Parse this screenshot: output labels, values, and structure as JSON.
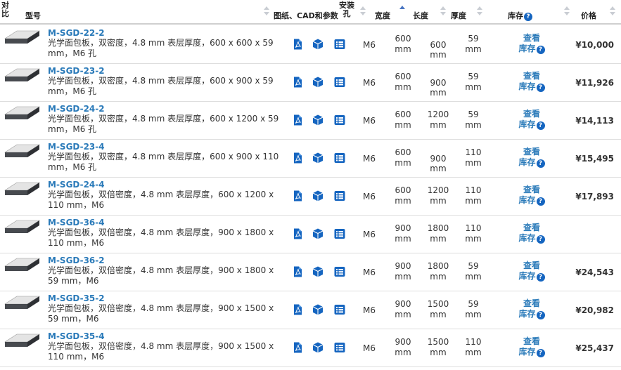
{
  "header": {
    "compare": "对比",
    "model": "型号",
    "docs": "图纸、CAD和参数",
    "holes": "安装孔",
    "width": "宽度",
    "length": "长度",
    "thickness": "厚度",
    "stock": "库存",
    "price": "价格"
  },
  "stock_link": "查看库存",
  "colors": {
    "link": "#2a7ab9",
    "icon": "#1565c0",
    "border": "#dedede"
  },
  "rows": [
    {
      "model": "M-SGD-22-2",
      "desc": "光学面包板，双密度，4.8 mm 表层厚度，600 x 600 x 59 mm，M6 孔",
      "holes": "M6",
      "width": "600 mm",
      "length": "600 mm",
      "thickness": "59 mm",
      "price": "¥10,000"
    },
    {
      "model": "M-SGD-23-2",
      "desc": "光学面包板，双密度，4.8 mm 表层厚度，600 x 900 x 59 mm，M6 孔",
      "holes": "M6",
      "width": "600 mm",
      "length": "900 mm",
      "thickness": "59 mm",
      "price": "¥11,926"
    },
    {
      "model": "M-SGD-24-2",
      "desc": "光学面包板，双密度，4.8 mm 表层厚度，600 x 1200 x 59 mm，M6 孔",
      "holes": "M6",
      "width": "600 mm",
      "length": "1200 mm",
      "thickness": "59 mm",
      "price": "¥14,113"
    },
    {
      "model": "M-SGD-23-4",
      "desc": "光学面包板，双密度，4.8 mm 表层厚度，600 x 900 x 110 mm，M6 孔",
      "holes": "M6",
      "width": "600 mm",
      "length": "900 mm",
      "thickness": "110 mm",
      "price": "¥15,495"
    },
    {
      "model": "M-SGD-24-4",
      "desc": "光学面包板，双倍密度，4.8 mm 表层厚度，600 x 1200 x 110 mm，M6",
      "holes": "M6",
      "width": "600 mm",
      "length": "1200 mm",
      "thickness": "110 mm",
      "price": "¥17,893"
    },
    {
      "model": "M-SGD-36-4",
      "desc": "光学面包板，双倍密度，4.8 mm 表层厚度，900 x 1800 x 110 mm，M6",
      "holes": "M6",
      "width": "900 mm",
      "length": "1800 mm",
      "thickness": "110 mm",
      "price": ""
    },
    {
      "model": "M-SGD-36-2",
      "desc": "光学面包板，双倍密度，4.8 mm 表层厚度，900 x 1800 x 59 mm，M6",
      "holes": "M6",
      "width": "900 mm",
      "length": "1800 mm",
      "thickness": "59 mm",
      "price": "¥24,543"
    },
    {
      "model": "M-SGD-35-2",
      "desc": "光学面包板，双倍密度，4.8 mm 表层厚度，900 x 1500 x 59 mm，M6",
      "holes": "M6",
      "width": "900 mm",
      "length": "1500 mm",
      "thickness": "59 mm",
      "price": "¥20,982"
    },
    {
      "model": "M-SGD-35-4",
      "desc": "光学面包板，双倍密度，4.8 mm 表层厚度，900 x 1500 x 110 mm，M6",
      "holes": "M6",
      "width": "900 mm",
      "length": "1500 mm",
      "thickness": "110 mm",
      "price": "¥25,437"
    }
  ]
}
